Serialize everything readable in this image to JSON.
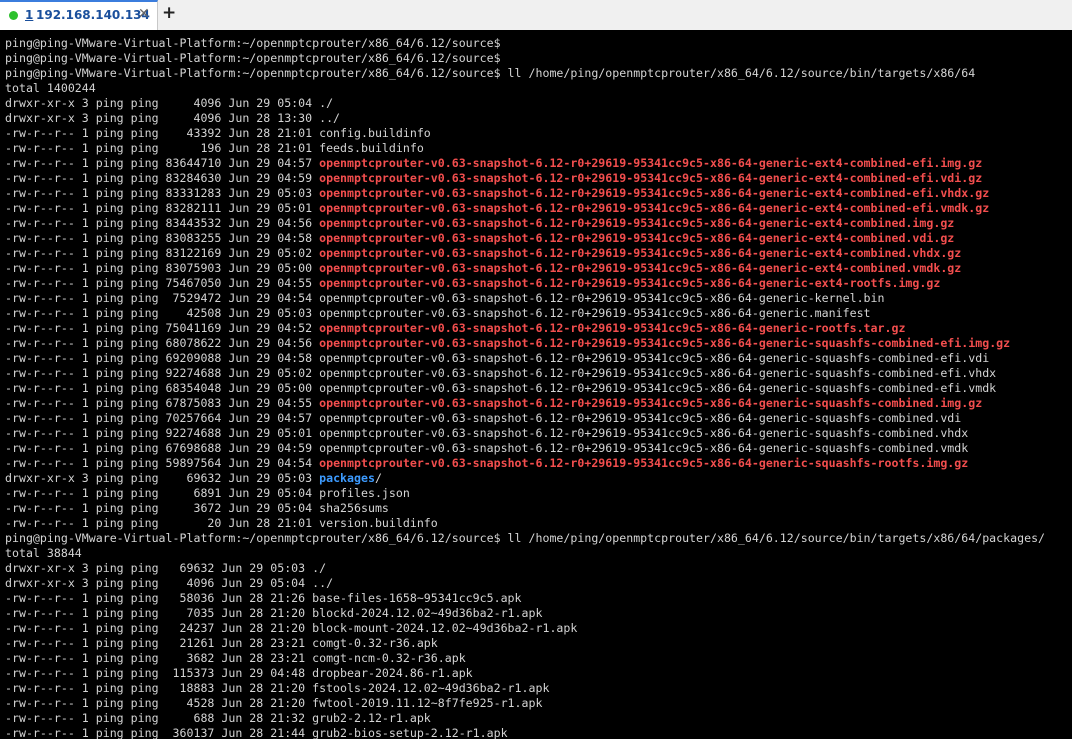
{
  "tab": {
    "number": "1",
    "title": "192.168.140.134",
    "status_color": "#2ec12e",
    "close_glyph": "✕",
    "new_tab_glyph": "+"
  },
  "colors": {
    "background": "#000000",
    "text": "#d4d4d4",
    "archive": "#f34e4e",
    "directory": "#3d9bff"
  },
  "terminal": {
    "lines": [
      [
        {
          "t": "ping@ping-VMware-Virtual-Platform:~/openmptcprouter/x86_64/6.12/source$"
        }
      ],
      [
        {
          "t": "ping@ping-VMware-Virtual-Platform:~/openmptcprouter/x86_64/6.12/source$"
        }
      ],
      [
        {
          "t": "ping@ping-VMware-Virtual-Platform:~/openmptcprouter/x86_64/6.12/source$ ll /home/ping/openmptcprouter/x86_64/6.12/source/bin/targets/x86/64"
        }
      ],
      [
        {
          "t": "total 1400244"
        }
      ],
      [
        {
          "t": "drwxr-xr-x 3 ping ping     4096 Jun 29 05:04 ./"
        }
      ],
      [
        {
          "t": "drwxr-xr-x 3 ping ping     4096 Jun 28 13:30 ../"
        }
      ],
      [
        {
          "t": "-rw-r--r-- 1 ping ping    43392 Jun 28 21:01 config.buildinfo"
        }
      ],
      [
        {
          "t": "-rw-r--r-- 1 ping ping      196 Jun 28 21:01 feeds.buildinfo"
        }
      ],
      [
        {
          "t": "-rw-r--r-- 1 ping ping 83644710 Jun 29 04:57 "
        },
        {
          "t": "openmptcprouter-v0.63-snapshot-6.12-r0+29619-95341cc9c5-x86-64-generic-ext4-combined-efi.img.gz",
          "s": "bold-red"
        }
      ],
      [
        {
          "t": "-rw-r--r-- 1 ping ping 83284630 Jun 29 04:59 "
        },
        {
          "t": "openmptcprouter-v0.63-snapshot-6.12-r0+29619-95341cc9c5-x86-64-generic-ext4-combined-efi.vdi.gz",
          "s": "bold-red"
        }
      ],
      [
        {
          "t": "-rw-r--r-- 1 ping ping 83331283 Jun 29 05:03 "
        },
        {
          "t": "openmptcprouter-v0.63-snapshot-6.12-r0+29619-95341cc9c5-x86-64-generic-ext4-combined-efi.vhdx.gz",
          "s": "bold-red"
        }
      ],
      [
        {
          "t": "-rw-r--r-- 1 ping ping 83282111 Jun 29 05:01 "
        },
        {
          "t": "openmptcprouter-v0.63-snapshot-6.12-r0+29619-95341cc9c5-x86-64-generic-ext4-combined-efi.vmdk.gz",
          "s": "bold-red"
        }
      ],
      [
        {
          "t": "-rw-r--r-- 1 ping ping 83443532 Jun 29 04:56 "
        },
        {
          "t": "openmptcprouter-v0.63-snapshot-6.12-r0+29619-95341cc9c5-x86-64-generic-ext4-combined.img.gz",
          "s": "bold-red"
        }
      ],
      [
        {
          "t": "-rw-r--r-- 1 ping ping 83083255 Jun 29 04:58 "
        },
        {
          "t": "openmptcprouter-v0.63-snapshot-6.12-r0+29619-95341cc9c5-x86-64-generic-ext4-combined.vdi.gz",
          "s": "bold-red"
        }
      ],
      [
        {
          "t": "-rw-r--r-- 1 ping ping 83122169 Jun 29 05:02 "
        },
        {
          "t": "openmptcprouter-v0.63-snapshot-6.12-r0+29619-95341cc9c5-x86-64-generic-ext4-combined.vhdx.gz",
          "s": "bold-red"
        }
      ],
      [
        {
          "t": "-rw-r--r-- 1 ping ping 83075903 Jun 29 05:00 "
        },
        {
          "t": "openmptcprouter-v0.63-snapshot-6.12-r0+29619-95341cc9c5-x86-64-generic-ext4-combined.vmdk.gz",
          "s": "bold-red"
        }
      ],
      [
        {
          "t": "-rw-r--r-- 1 ping ping 75467050 Jun 29 04:55 "
        },
        {
          "t": "openmptcprouter-v0.63-snapshot-6.12-r0+29619-95341cc9c5-x86-64-generic-ext4-rootfs.img.gz",
          "s": "bold-red"
        }
      ],
      [
        {
          "t": "-rw-r--r-- 1 ping ping  7529472 Jun 29 04:54 openmptcprouter-v0.63-snapshot-6.12-r0+29619-95341cc9c5-x86-64-generic-kernel.bin"
        }
      ],
      [
        {
          "t": "-rw-r--r-- 1 ping ping    42508 Jun 29 05:03 openmptcprouter-v0.63-snapshot-6.12-r0+29619-95341cc9c5-x86-64-generic.manifest"
        }
      ],
      [
        {
          "t": "-rw-r--r-- 1 ping ping 75041169 Jun 29 04:52 "
        },
        {
          "t": "openmptcprouter-v0.63-snapshot-6.12-r0+29619-95341cc9c5-x86-64-generic-rootfs.tar.gz",
          "s": "bold-red"
        }
      ],
      [
        {
          "t": "-rw-r--r-- 1 ping ping 68078622 Jun 29 04:56 "
        },
        {
          "t": "openmptcprouter-v0.63-snapshot-6.12-r0+29619-95341cc9c5-x86-64-generic-squashfs-combined-efi.img.gz",
          "s": "bold-red"
        }
      ],
      [
        {
          "t": "-rw-r--r-- 1 ping ping 69209088 Jun 29 04:58 openmptcprouter-v0.63-snapshot-6.12-r0+29619-95341cc9c5-x86-64-generic-squashfs-combined-efi.vdi"
        }
      ],
      [
        {
          "t": "-rw-r--r-- 1 ping ping 92274688 Jun 29 05:02 openmptcprouter-v0.63-snapshot-6.12-r0+29619-95341cc9c5-x86-64-generic-squashfs-combined-efi.vhdx"
        }
      ],
      [
        {
          "t": "-rw-r--r-- 1 ping ping 68354048 Jun 29 05:00 openmptcprouter-v0.63-snapshot-6.12-r0+29619-95341cc9c5-x86-64-generic-squashfs-combined-efi.vmdk"
        }
      ],
      [
        {
          "t": "-rw-r--r-- 1 ping ping 67875083 Jun 29 04:55 "
        },
        {
          "t": "openmptcprouter-v0.63-snapshot-6.12-r0+29619-95341cc9c5-x86-64-generic-squashfs-combined.img.gz",
          "s": "bold-red"
        }
      ],
      [
        {
          "t": "-rw-r--r-- 1 ping ping 70257664 Jun 29 04:57 openmptcprouter-v0.63-snapshot-6.12-r0+29619-95341cc9c5-x86-64-generic-squashfs-combined.vdi"
        }
      ],
      [
        {
          "t": "-rw-r--r-- 1 ping ping 92274688 Jun 29 05:01 openmptcprouter-v0.63-snapshot-6.12-r0+29619-95341cc9c5-x86-64-generic-squashfs-combined.vhdx"
        }
      ],
      [
        {
          "t": "-rw-r--r-- 1 ping ping 67698688 Jun 29 04:59 openmptcprouter-v0.63-snapshot-6.12-r0+29619-95341cc9c5-x86-64-generic-squashfs-combined.vmdk"
        }
      ],
      [
        {
          "t": "-rw-r--r-- 1 ping ping 59897564 Jun 29 04:54 "
        },
        {
          "t": "openmptcprouter-v0.63-snapshot-6.12-r0+29619-95341cc9c5-x86-64-generic-squashfs-rootfs.img.gz",
          "s": "bold-red"
        }
      ],
      [
        {
          "t": "drwxr-xr-x 3 ping ping    69632 Jun 29 05:03 "
        },
        {
          "t": "packages",
          "s": "blue"
        },
        {
          "t": "/"
        }
      ],
      [
        {
          "t": "-rw-r--r-- 1 ping ping     6891 Jun 29 05:04 profiles.json"
        }
      ],
      [
        {
          "t": "-rw-r--r-- 1 ping ping     3672 Jun 29 05:04 sha256sums"
        }
      ],
      [
        {
          "t": "-rw-r--r-- 1 ping ping       20 Jun 28 21:01 version.buildinfo"
        }
      ],
      [
        {
          "t": "ping@ping-VMware-Virtual-Platform:~/openmptcprouter/x86_64/6.12/source$ ll /home/ping/openmptcprouter/x86_64/6.12/source/bin/targets/x86/64/packages/"
        }
      ],
      [
        {
          "t": "total 38844"
        }
      ],
      [
        {
          "t": "drwxr-xr-x 3 ping ping   69632 Jun 29 05:03 ./"
        }
      ],
      [
        {
          "t": "drwxr-xr-x 3 ping ping    4096 Jun 29 05:04 ../"
        }
      ],
      [
        {
          "t": "-rw-r--r-- 1 ping ping   58036 Jun 28 21:26 base-files-1658~95341cc9c5.apk"
        }
      ],
      [
        {
          "t": "-rw-r--r-- 1 ping ping    7035 Jun 28 21:20 blockd-2024.12.02~49d36ba2-r1.apk"
        }
      ],
      [
        {
          "t": "-rw-r--r-- 1 ping ping   24237 Jun 28 21:20 block-mount-2024.12.02~49d36ba2-r1.apk"
        }
      ],
      [
        {
          "t": "-rw-r--r-- 1 ping ping   21261 Jun 28 23:21 comgt-0.32-r36.apk"
        }
      ],
      [
        {
          "t": "-rw-r--r-- 1 ping ping    3682 Jun 28 23:21 comgt-ncm-0.32-r36.apk"
        }
      ],
      [
        {
          "t": "-rw-r--r-- 1 ping ping  115373 Jun 29 04:48 dropbear-2024.86-r1.apk"
        }
      ],
      [
        {
          "t": "-rw-r--r-- 1 ping ping   18883 Jun 28 21:20 fstools-2024.12.02~49d36ba2-r1.apk"
        }
      ],
      [
        {
          "t": "-rw-r--r-- 1 ping ping    4528 Jun 28 21:20 fwtool-2019.11.12~8f7fe925-r1.apk"
        }
      ],
      [
        {
          "t": "-rw-r--r-- 1 ping ping     688 Jun 28 21:32 grub2-2.12-r1.apk"
        }
      ],
      [
        {
          "t": "-rw-r--r-- 1 ping ping  360137 Jun 28 21:44 grub2-bios-setup-2.12-r1.apk"
        }
      ]
    ]
  }
}
